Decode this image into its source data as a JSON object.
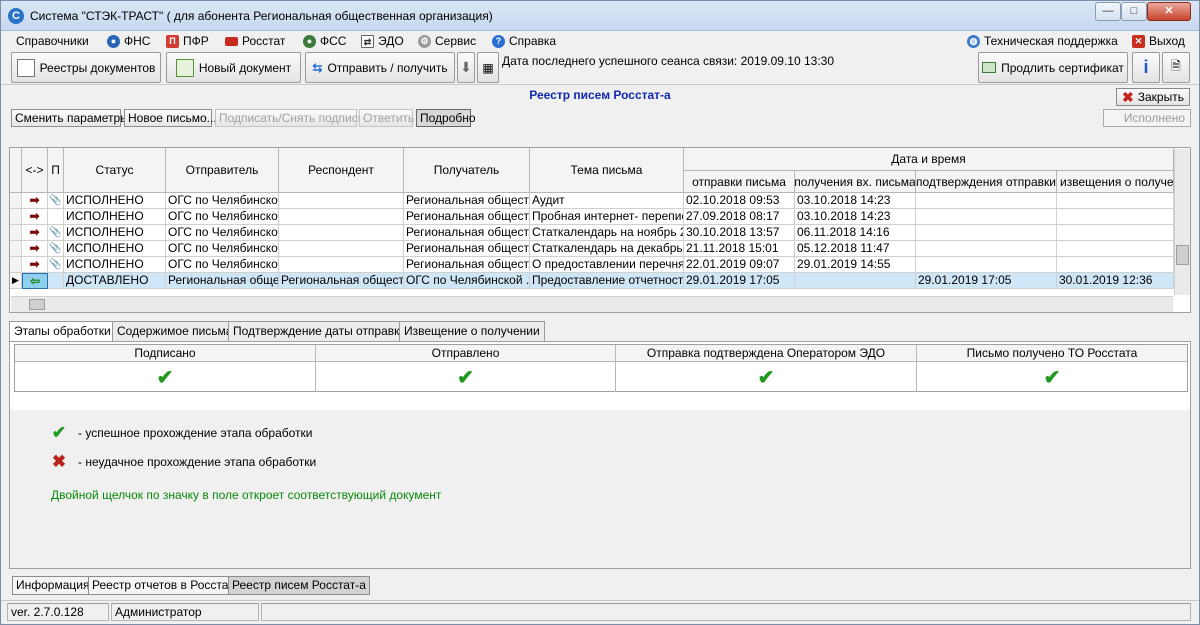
{
  "window": {
    "title": "Система \"СТЭК-ТРАСТ\" ( для абонента Региональная общественная организация)",
    "icon": "app-logo-icon",
    "min_label": "—",
    "max_label": "□",
    "close_label": "✕"
  },
  "menu": {
    "items": [
      {
        "label": "Справочники"
      },
      {
        "label": "ФНС",
        "icon": "fns-icon"
      },
      {
        "label": "ПФР",
        "icon": "pfr-icon"
      },
      {
        "label": "Росстат",
        "icon": "rosstat-icon"
      },
      {
        "label": "ФСС",
        "icon": "fss-icon"
      },
      {
        "label": "ЭДО",
        "icon": "edo-icon"
      },
      {
        "label": "Сервис",
        "icon": "gear-icon"
      },
      {
        "label": "Справка",
        "icon": "help-icon"
      }
    ],
    "support_label": "Техническая поддержка",
    "exit_label": "Выход"
  },
  "toolbar": {
    "registers_label": "Реестры документов",
    "new_doc_label": "Новый документ",
    "send_receive_label": "Отправить / получить",
    "last_session": "Дата последнего успешного сеанса связи: 2019.09.10 13:30",
    "renew_cert_label": "Продлить сертификат",
    "info_label": "i"
  },
  "registry": {
    "title": "Реестр писем Росстат-а",
    "close_label": "Закрыть",
    "actions": {
      "change_params": "Сменить параметры",
      "new_letter": "Новое письмо...",
      "sign_unsign": "Подписать/Снять подпись",
      "reply": "Ответить",
      "details": "Подробно"
    },
    "filter_value": "Исполнено"
  },
  "grid": {
    "headers": {
      "dir": "<->",
      "p": "П",
      "status": "Статус",
      "sender": "Отправитель",
      "respondent": "Респондент",
      "recipient": "Получатель",
      "subject": "Тема письма",
      "datetime_group": "Дата и время",
      "sent": "отправки письма",
      "received": "получения вх. письма",
      "confirm": "подтверждения отправки",
      "notice": "извещения о получени"
    },
    "rows": [
      {
        "dir": "➡",
        "clip": "📎",
        "status": "ИСПОЛНЕНО",
        "sender": "ОГС по Челябинско...",
        "respondent": "",
        "recipient": "Региональная общест...",
        "subject": "Аудит",
        "sent": "02.10.2018 09:53",
        "received": "03.10.2018 14:23",
        "confirm": "",
        "notice": ""
      },
      {
        "dir": "➡",
        "clip": "",
        "status": "ИСПОЛНЕНО",
        "sender": "ОГС по Челябинско...",
        "respondent": "",
        "recipient": "Региональная общест...",
        "subject": "Пробная интернет- перепис...",
        "sent": "27.09.2018 08:17",
        "received": "03.10.2018 14:23",
        "confirm": "",
        "notice": ""
      },
      {
        "dir": "➡",
        "clip": "📎",
        "status": "ИСПОЛНЕНО",
        "sender": "ОГС по Челябинско...",
        "respondent": "",
        "recipient": "Региональная общест...",
        "subject": "Статкалендарь на ноябрь 2...",
        "sent": "30.10.2018 13:57",
        "received": "06.11.2018 14:16",
        "confirm": "",
        "notice": ""
      },
      {
        "dir": "➡",
        "clip": "📎",
        "status": "ИСПОЛНЕНО",
        "sender": "ОГС по Челябинско...",
        "respondent": "",
        "recipient": "Региональная общест...",
        "subject": "Статкалендарь  на декабрь...",
        "sent": "21.11.2018 15:01",
        "received": "05.12.2018 11:47",
        "confirm": "",
        "notice": ""
      },
      {
        "dir": "➡",
        "clip": "📎",
        "status": "ИСПОЛНЕНО",
        "sender": "ОГС по Челябинско...",
        "respondent": "",
        "recipient": "Региональная общест...",
        "subject": "О предоставлении перечня ...",
        "sent": "22.01.2019 09:07",
        "received": "29.01.2019 14:55",
        "confirm": "",
        "notice": ""
      },
      {
        "dir": "⇦",
        "clip": "",
        "status": "ДОСТАВЛЕНО",
        "sender": "Региональная обще...",
        "respondent": "Региональная общест...",
        "recipient": "ОГС по Челябинской ...",
        "subject": "Предоставление отчетности",
        "sent": "29.01.2019 17:05",
        "received": "",
        "confirm": "29.01.2019 17:05",
        "notice": "30.01.2019 12:36"
      }
    ]
  },
  "detail_tabs": [
    "Этапы обработки",
    "Содержимое письма",
    "Подтверждение даты отправки",
    "Извещение о получении"
  ],
  "stages": {
    "headers": [
      "Подписано",
      "Отправлено",
      "Отправка подтверждена Оператором ЭДО",
      "Письмо получено ТО Росстата"
    ],
    "mark": "✔"
  },
  "legend": {
    "ok_symbol": "✔",
    "ok_text": "-  успешное прохождение этапа обработки",
    "bad_symbol": "✖",
    "bad_text": "-  неудачное прохождение этапа обработки",
    "hint": "Двойной щелчок по значку в поле откроет соответствующий документ"
  },
  "window_tabs": [
    "Информация",
    "Реестр отчетов в Росстат",
    "Реестр писем Росстат-а"
  ],
  "status": {
    "version": "ver. 2.7.0.128",
    "user": "Администратор"
  },
  "colors": {
    "accent_title": "#1029b0",
    "selected_row": "#cfe6f7",
    "success": "#1f9a1f",
    "error": "#b8231a",
    "hint": "#0a8a0a"
  }
}
